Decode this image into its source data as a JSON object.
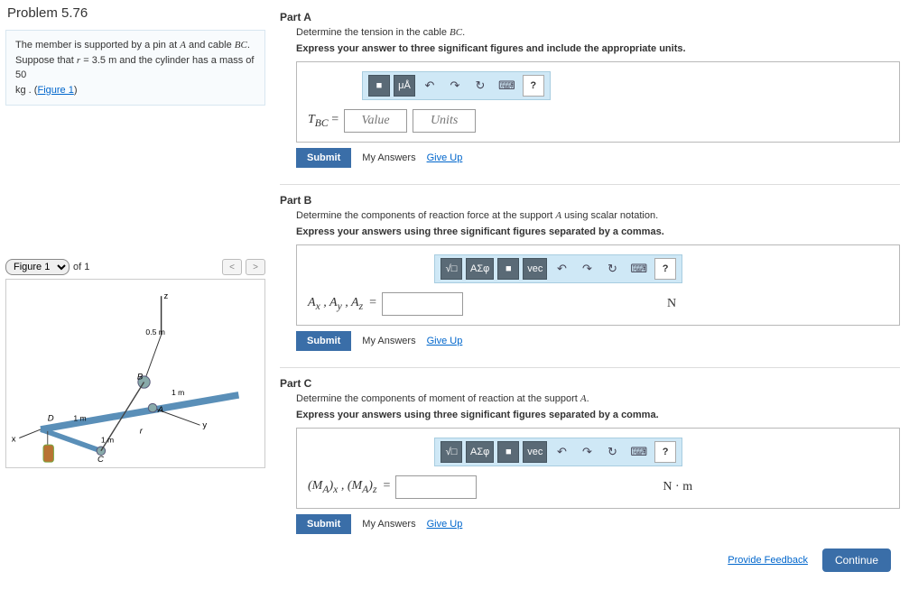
{
  "problem": {
    "title": "Problem 5.76",
    "desc_line1_pre": "The member is supported by a pin at ",
    "desc_A": "A",
    "desc_line1_mid": " and cable ",
    "desc_BC": "BC",
    "desc_line1_post": ".",
    "desc_line2_pre": "Suppose that ",
    "desc_r": "r",
    "desc_line2_mid": " = 3.5 ",
    "desc_m": "m",
    "desc_line2_post": " and the cylinder has a mass of 50",
    "desc_line3_pre": "kg",
    "desc_line3_mid": " . (",
    "desc_fig_link": "Figure 1",
    "desc_line3_post": ")"
  },
  "figure": {
    "select": "Figure 1",
    "of": "of 1",
    "labels": {
      "z": "z",
      "x": "x",
      "y": "y",
      "B": "B",
      "A": "A",
      "C": "C",
      "D": "D",
      "m05": "0.5 m",
      "m1a": "1 m",
      "m1b": "1 m",
      "m1c": "1 m",
      "r": "r"
    }
  },
  "partA": {
    "label": "Part A",
    "q_pre": "Determine the tension in the cable ",
    "q_BC": "BC",
    "q_post": ".",
    "hint": "Express your answer to three significant figures and include the appropriate units.",
    "tb": {
      "b1": "■",
      "b2": "μÅ",
      "undo": "↶",
      "redo": "↷",
      "reset": "↻",
      "kb": "⌨",
      "help": "?"
    },
    "lhs": "T_{BC} =",
    "value_ph": "Value",
    "units_ph": "Units",
    "submit": "Submit",
    "myans": "My Answers",
    "giveup": "Give Up"
  },
  "partB": {
    "label": "Part B",
    "q_pre": "Determine the components of reaction force at the support ",
    "q_A": "A",
    "q_post": " using scalar notation.",
    "hint": "Express your answers using three significant figures separated by a commas.",
    "tb": {
      "b1": "√□",
      "b2": "ΑΣφ",
      "b3": "■",
      "vec": "vec",
      "undo": "↶",
      "redo": "↷",
      "reset": "↻",
      "kb": "⌨",
      "help": "?"
    },
    "lhs": "A_x , A_y , A_z  =",
    "unit": "N",
    "submit": "Submit",
    "myans": "My Answers",
    "giveup": "Give Up"
  },
  "partC": {
    "label": "Part C",
    "q_pre": "Determine the components of moment of reaction at the support ",
    "q_A": "A",
    "q_post": ".",
    "hint": "Express your answers using three significant figures separated by a comma.",
    "tb": {
      "b1": "√□",
      "b2": "ΑΣφ",
      "b3": "■",
      "vec": "vec",
      "undo": "↶",
      "redo": "↷",
      "reset": "↻",
      "kb": "⌨",
      "help": "?"
    },
    "lhs": "(M_A)_x , (M_A)_z  =",
    "unit": "N · m",
    "submit": "Submit",
    "myans": "My Answers",
    "giveup": "Give Up"
  },
  "footer": {
    "feedback": "Provide Feedback",
    "continue": "Continue"
  }
}
